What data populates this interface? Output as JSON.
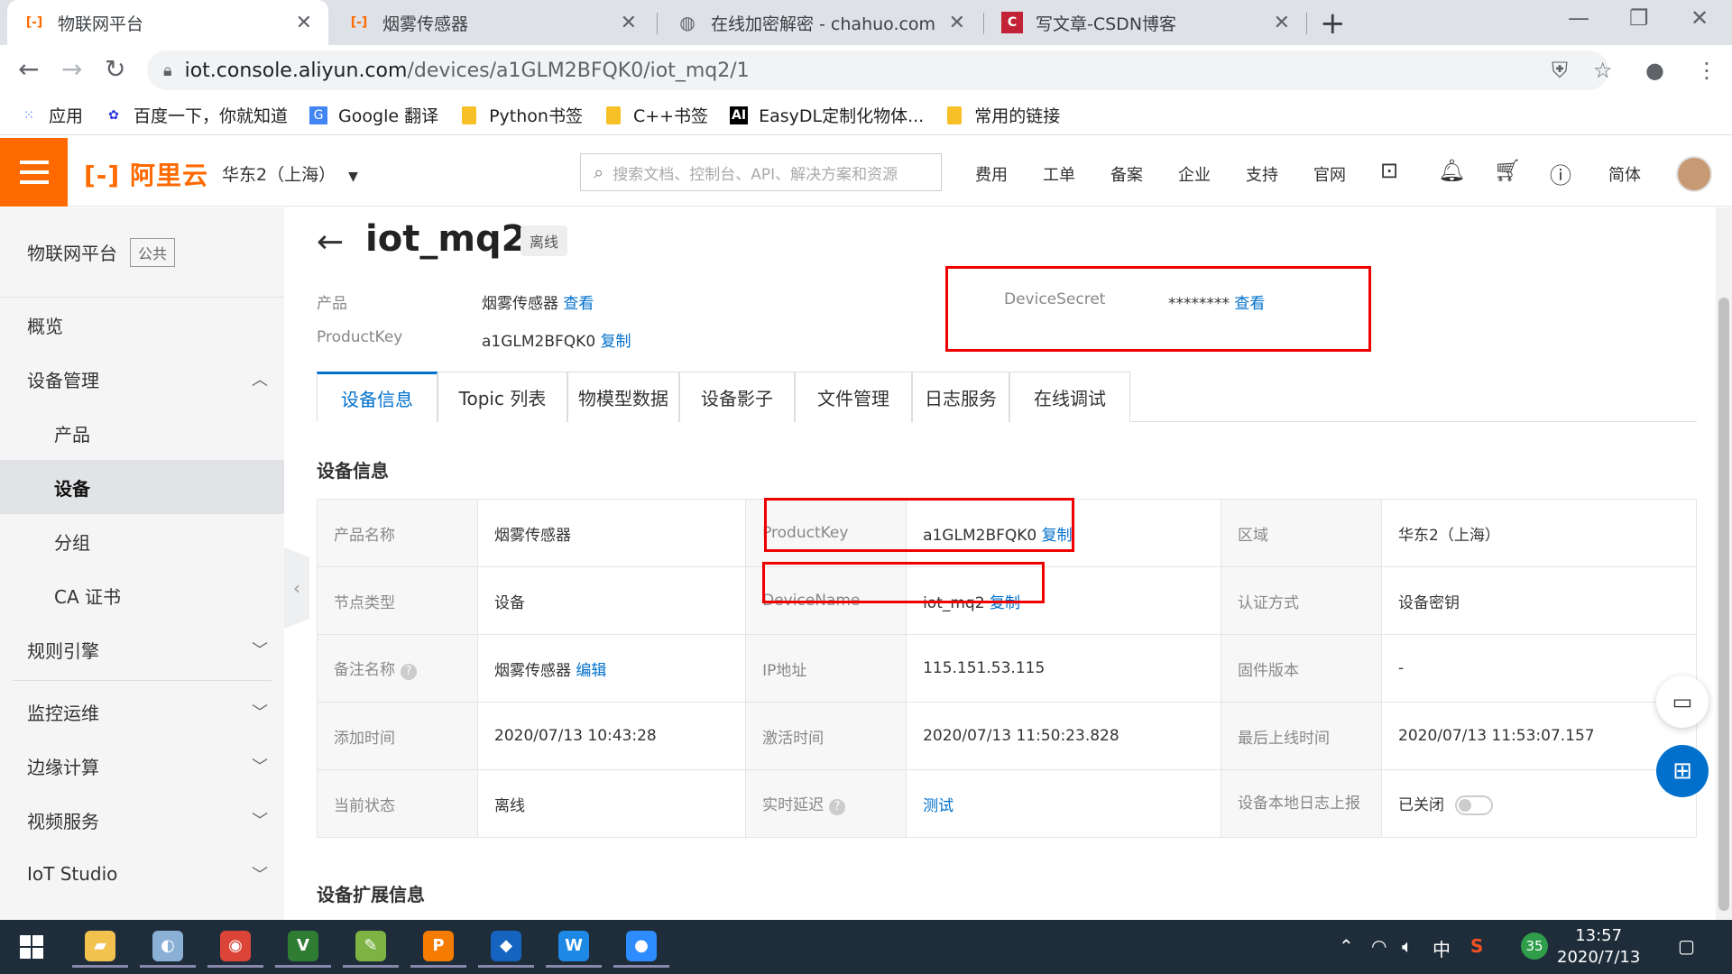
{
  "browser": {
    "tabs": [
      {
        "title": "物联网平台",
        "icon": "aliyun-icon",
        "color": "#ff6a00",
        "active": true
      },
      {
        "title": "烟雾传感器",
        "icon": "aliyun-icon",
        "color": "#ff6a00",
        "active": false
      },
      {
        "title": "在线加密解密 - chahuo.com",
        "icon": "globe-icon",
        "color": "#5f6368",
        "active": false
      },
      {
        "title": "写文章-CSDN博客",
        "icon": "csdn-icon",
        "color": "#c32136",
        "active": false
      }
    ],
    "url_host": "iot.console.aliyun.com",
    "url_path": "/devices/a1GLM2BFQK0/iot_mq2/1",
    "bookmarks": [
      {
        "label": "应用",
        "icon": "apps-grid-icon"
      },
      {
        "label": "百度一下，你就知道",
        "icon": "baidu-icon"
      },
      {
        "label": "Google 翻译",
        "icon": "google-translate-icon"
      },
      {
        "label": "Python书签",
        "icon": "folder-icon"
      },
      {
        "label": "C++书签",
        "icon": "folder-icon"
      },
      {
        "label": "EasyDL定制化物体...",
        "icon": "ai-icon"
      },
      {
        "label": "常用的链接",
        "icon": "folder-icon"
      }
    ]
  },
  "header": {
    "logo": "阿里云",
    "region": "华东2（上海）",
    "search_placeholder": "搜索文档、控制台、API、解决方案和资源",
    "nav": [
      "费用",
      "工单",
      "备案",
      "企业",
      "支持",
      "官网"
    ],
    "lang": "简体",
    "brand_color": "#ff6a00"
  },
  "sidebar": {
    "title": "物联网平台",
    "tag": "公共",
    "items": [
      {
        "label": "概览",
        "level": 0,
        "chevron": ""
      },
      {
        "label": "设备管理",
        "level": 0,
        "chevron": "up"
      },
      {
        "label": "产品",
        "level": 1,
        "chevron": ""
      },
      {
        "label": "设备",
        "level": 1,
        "chevron": "",
        "active": true
      },
      {
        "label": "分组",
        "level": 1,
        "chevron": ""
      },
      {
        "label": "CA 证书",
        "level": 1,
        "chevron": ""
      },
      {
        "label": "规则引擎",
        "level": 0,
        "chevron": "down"
      },
      {
        "label": "监控运维",
        "level": 0,
        "chevron": "down"
      },
      {
        "label": "边缘计算",
        "level": 0,
        "chevron": "down"
      },
      {
        "label": "视频服务",
        "level": 0,
        "chevron": "down"
      },
      {
        "label": "IoT Studio",
        "level": 0,
        "chevron": "down"
      }
    ]
  },
  "device": {
    "name": "iot_mq2",
    "status": "离线",
    "product_label": "产品",
    "product_value": "烟雾传感器",
    "product_link": "查看",
    "productkey_label": "ProductKey",
    "productkey_value": "a1GLM2BFQK0",
    "copy_link": "复制",
    "secret_label": "DeviceSecret",
    "secret_value": "********",
    "secret_link": "查看"
  },
  "tabs": [
    "设备信息",
    "Topic 列表",
    "物模型数据",
    "设备影子",
    "文件管理",
    "日志服务",
    "在线调试"
  ],
  "active_tab": 0,
  "section_title": "设备信息",
  "section_title_2": "设备扩展信息",
  "info": {
    "product_name_label": "产品名称",
    "product_name": "烟雾传感器",
    "pk_label": "ProductKey",
    "pk_value": "a1GLM2BFQK0",
    "pk_copy": "复制",
    "region_label": "区域",
    "region_value": "华东2（上海）",
    "node_label": "节点类型",
    "node_value": "设备",
    "dn_label": "DeviceName",
    "dn_value": "iot_mq2",
    "dn_copy": "复制",
    "auth_label": "认证方式",
    "auth_value": "设备密钥",
    "note_label": "备注名称",
    "note_value": "烟雾传感器",
    "note_edit": "编辑",
    "ip_label": "IP地址",
    "ip_value": "115.151.53.115",
    "fw_label": "固件版本",
    "fw_value": "-",
    "added_label": "添加时间",
    "added_value": "2020/07/13 10:43:28",
    "activated_label": "激活时间",
    "activated_value": "2020/07/13 11:50:23.828",
    "lastonline_label": "最后上线时间",
    "lastonline_value": "2020/07/13 11:53:07.157",
    "state_label": "当前状态",
    "state_value": "离线",
    "latency_label": "实时延迟",
    "latency_link": "测试",
    "locallog_label": "设备本地日志上报",
    "locallog_value": "已关闭"
  },
  "taskbar": {
    "apps": [
      {
        "name": "file-explorer-icon",
        "color": "#f2c14e"
      },
      {
        "name": "paint-icon",
        "color": "#8bb0d6"
      },
      {
        "name": "chrome-icon",
        "color": "#db4437"
      },
      {
        "name": "vs-code-icon",
        "color": "#2e7d32"
      },
      {
        "name": "notepad-plus-icon",
        "color": "#7cb342"
      },
      {
        "name": "pdf-reader-icon",
        "color": "#f57c00"
      },
      {
        "name": "hawk-icon",
        "color": "#1565c0"
      },
      {
        "name": "wps-icon",
        "color": "#1e88e5"
      },
      {
        "name": "zoom-icon",
        "color": "#2d8cff"
      }
    ],
    "ime": "中",
    "badge": "35",
    "time": "13:57",
    "date": "2020/7/13"
  }
}
